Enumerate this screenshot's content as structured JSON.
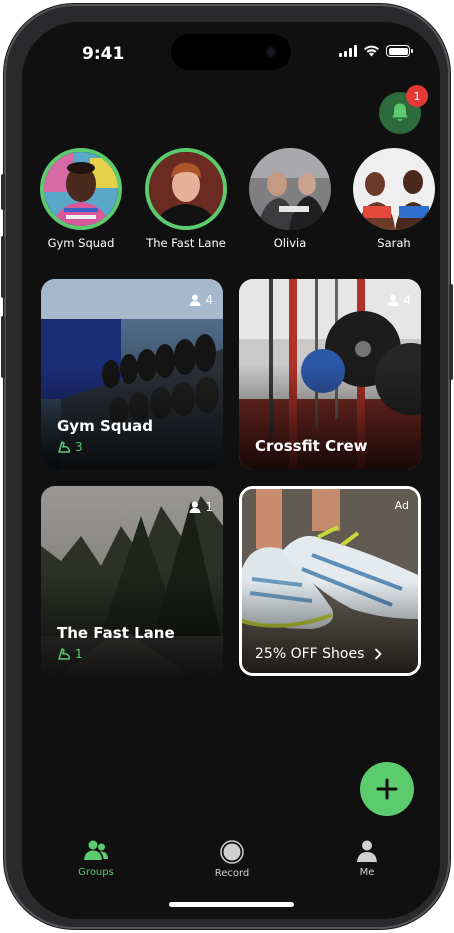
{
  "status": {
    "time": "9:41"
  },
  "notifications": {
    "count": "1"
  },
  "stories": [
    {
      "name": "Gym Squad"
    },
    {
      "name": "The Fast Lane"
    },
    {
      "name": "Olivia"
    },
    {
      "name": "Sarah"
    }
  ],
  "groups": [
    {
      "title": "Gym Squad",
      "members": "4",
      "activity": "3"
    },
    {
      "title": "Crossfit Crew",
      "members": "4"
    },
    {
      "title": "The Fast Lane",
      "members": "1",
      "activity": "1"
    }
  ],
  "ad": {
    "tag": "Ad",
    "cta": "25% OFF Shoes"
  },
  "tabs": [
    {
      "label": "Groups",
      "icon": "groups-icon"
    },
    {
      "label": "Record",
      "icon": "record-icon"
    },
    {
      "label": "Me",
      "icon": "person-icon"
    }
  ],
  "colors": {
    "accent": "#5ccb6e",
    "badge": "#e53935",
    "background": "#101010"
  }
}
